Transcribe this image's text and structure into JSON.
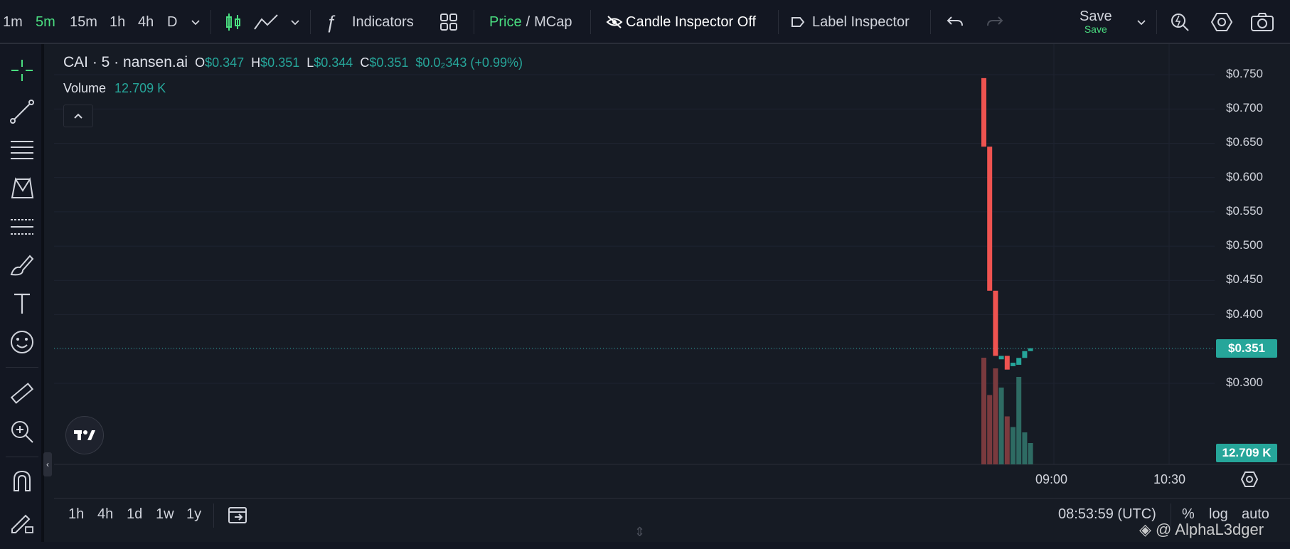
{
  "toolbar": {
    "intervals": [
      "1m",
      "5m",
      "15m",
      "1h",
      "4h",
      "D"
    ],
    "active_interval": "5m",
    "indicators_label": "Indicators",
    "price_label": "Price",
    "slash": "/",
    "mcap_label": "MCap",
    "candle_inspector_label": "Candle Inspector Off",
    "label_inspector_label": "Label Inspector",
    "save_label": "Save",
    "save_sublabel": "Save"
  },
  "legend": {
    "symbol": "CAI · 5 · nansen.ai",
    "open_key": "O",
    "open": "$0.347",
    "high_key": "H",
    "high": "$0.351",
    "low_key": "L",
    "low": "$0.344",
    "close_key": "C",
    "close": "$0.351",
    "change": "$0.0₂343 (+0.99%)",
    "volume_label": "Volume",
    "volume_value": "12.709 K"
  },
  "price_axis": {
    "ticks": [
      "$0.750",
      "$0.700",
      "$0.650",
      "$0.600",
      "$0.550",
      "$0.500",
      "$0.450",
      "$0.400",
      "$0.300"
    ],
    "current_price": "$0.351",
    "current_volume": "12.709 K"
  },
  "time_axis": {
    "ticks": [
      "09:00",
      "10:30"
    ]
  },
  "chart_data": {
    "type": "candlestick",
    "symbol": "CAI",
    "interval": "5m",
    "ylim": [
      0.28,
      0.78
    ],
    "candles": [
      {
        "o": 0.745,
        "c": 0.645,
        "dir": "down"
      },
      {
        "o": 0.645,
        "c": 0.435,
        "dir": "down"
      },
      {
        "o": 0.435,
        "c": 0.34,
        "dir": "down"
      },
      {
        "o": 0.335,
        "c": 0.34,
        "dir": "up"
      },
      {
        "o": 0.34,
        "c": 0.32,
        "dir": "down"
      },
      {
        "o": 0.33,
        "c": 0.325,
        "dir": "up"
      },
      {
        "o": 0.327,
        "c": 0.337,
        "dir": "up"
      },
      {
        "o": 0.337,
        "c": 0.347,
        "dir": "up"
      },
      {
        "o": 0.347,
        "c": 0.351,
        "dir": "up"
      }
    ],
    "volumes": [
      1.0,
      0.65,
      0.9,
      0.72,
      0.45,
      0.35,
      0.82,
      0.3,
      0.2
    ],
    "volume_colors": [
      "down",
      "down",
      "down",
      "up",
      "down",
      "up",
      "up",
      "up",
      "up"
    ],
    "colors": {
      "up": "#26a69a",
      "down": "#ef5350",
      "up_volume": "#2e6b63",
      "down_volume": "#7a3a3e"
    }
  },
  "bottom": {
    "ranges": [
      "1h",
      "4h",
      "1d",
      "1w",
      "1y"
    ],
    "clock": "08:53:59 (UTC)",
    "percent": "%",
    "log": "log",
    "auto": "auto"
  },
  "watermark": "@ AlphaL3dger"
}
